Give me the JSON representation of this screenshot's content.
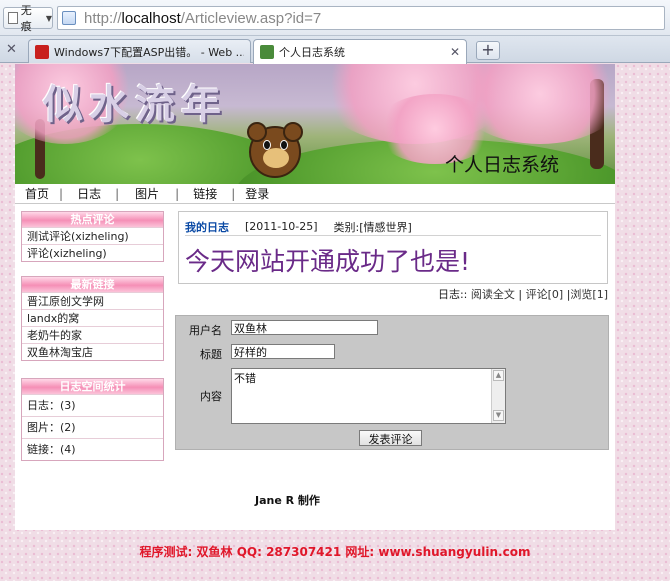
{
  "browser": {
    "compat_label": "无痕",
    "url_scheme_host": "http://",
    "url_host": "localhost",
    "url_path": "/Articleview.asp?id=7",
    "tabs": [
      {
        "label": "Windows7下配置ASP出错。 - Web ..."
      },
      {
        "label": "个人日志系统"
      }
    ],
    "new_tab": "+"
  },
  "site": {
    "logo": "似水流年",
    "system_title": "个人日志系统",
    "nav": [
      "首页",
      "日志",
      "图片",
      "链接",
      "登录"
    ]
  },
  "sidebar": {
    "hot_comments": {
      "title": "热点评论",
      "items": [
        "测试评论(xizheling)",
        "评论(xizheling)"
      ]
    },
    "links": {
      "title": "最新链接",
      "items": [
        "晋江原创文学网",
        "landx的窝",
        "老奶牛的家",
        "双鱼林淘宝店"
      ]
    },
    "stats": {
      "title": "日志空间统计",
      "items": [
        "日志：(3)",
        "图片：(2)",
        "链接：(4)"
      ]
    }
  },
  "article": {
    "section": "我的日志",
    "date": "[2011-10-25]",
    "category": "类别:[情感世界]",
    "headline": "今天网站开通成功了也是!",
    "stats_prefix": "日志::",
    "read_full": "阅读全文",
    "comments": "评论[0]",
    "views": "浏览[1]"
  },
  "comment_form": {
    "username_label": "用户名",
    "username_value": "双鱼林",
    "title_label": "标题",
    "title_value": "好样的",
    "content_label": "内容",
    "content_value": "不错",
    "submit_label": "发表评论"
  },
  "credit": "Jane R 制作",
  "footer": "程序测试: 双鱼林  QQ: 287307421  网址: www.shuangyulin.com"
}
